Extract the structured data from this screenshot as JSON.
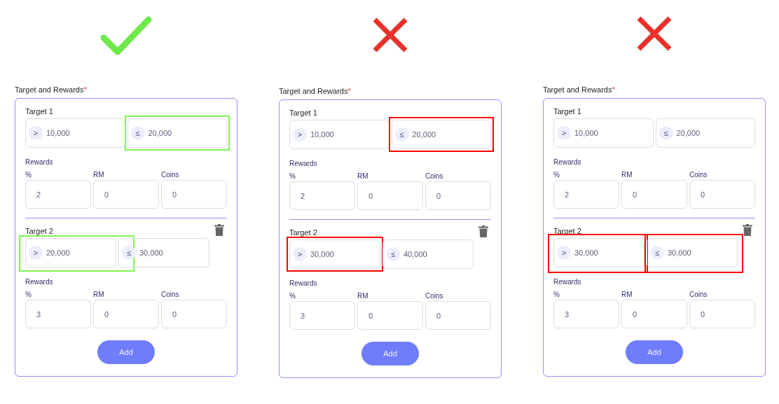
{
  "panels": [
    {
      "correct": true,
      "section_label": "Target and Rewards",
      "required_mark": "*",
      "targets": [
        {
          "title": "Target 1",
          "deletable": false,
          "range": [
            {
              "sign": ">",
              "value": "10,000",
              "highlighted": false
            },
            {
              "sign": "≤",
              "value": "20,000",
              "highlighted": true
            }
          ],
          "rewards_label": "Rewards",
          "rewards": [
            {
              "label": "%",
              "value": "2"
            },
            {
              "label": "RM",
              "value": "0"
            },
            {
              "label": "Coins",
              "value": "0"
            }
          ]
        },
        {
          "title": "Target 2",
          "deletable": true,
          "range": [
            {
              "sign": ">",
              "value": "20,000",
              "highlighted": true
            },
            {
              "sign": "≤",
              "value": "30,000",
              "highlighted": false
            }
          ],
          "rewards_label": "Rewards",
          "rewards": [
            {
              "label": "%",
              "value": "3"
            },
            {
              "label": "RM",
              "value": "0"
            },
            {
              "label": "Coins",
              "value": "0"
            }
          ]
        }
      ],
      "add_button": "Add"
    },
    {
      "correct": false,
      "section_label": "Target and Rewards",
      "required_mark": "*",
      "targets": [
        {
          "title": "Target 1",
          "deletable": false,
          "range": [
            {
              "sign": ">",
              "value": "10,000",
              "highlighted": false
            },
            {
              "sign": "≤",
              "value": "20,000",
              "highlighted": true
            }
          ],
          "rewards_label": "Rewards",
          "rewards": [
            {
              "label": "%",
              "value": "2"
            },
            {
              "label": "RM",
              "value": "0"
            },
            {
              "label": "Coins",
              "value": "0"
            }
          ]
        },
        {
          "title": "Target 2",
          "deletable": true,
          "range": [
            {
              "sign": ">",
              "value": "30,000",
              "highlighted": true
            },
            {
              "sign": "≤",
              "value": "40,000",
              "highlighted": false
            }
          ],
          "rewards_label": "Rewards",
          "rewards": [
            {
              "label": "%",
              "value": "3"
            },
            {
              "label": "RM",
              "value": "0"
            },
            {
              "label": "Coins",
              "value": "0"
            }
          ]
        }
      ],
      "add_button": "Add"
    },
    {
      "correct": false,
      "section_label": "Target and Rewards",
      "required_mark": "*",
      "targets": [
        {
          "title": "Target 1",
          "deletable": false,
          "range": [
            {
              "sign": ">",
              "value": "10,000",
              "highlighted": false
            },
            {
              "sign": "≤",
              "value": "20,000",
              "highlighted": false
            }
          ],
          "rewards_label": "Rewards",
          "rewards": [
            {
              "label": "%",
              "value": "2"
            },
            {
              "label": "RM",
              "value": "0"
            },
            {
              "label": "Coins",
              "value": "0"
            }
          ]
        },
        {
          "title": "Target 2",
          "deletable": true,
          "range": [
            {
              "sign": ">",
              "value": "30,000",
              "highlighted": true
            },
            {
              "sign": "≤",
              "value": "30,000",
              "highlighted": true
            }
          ],
          "rewards_label": "Rewards",
          "rewards": [
            {
              "label": "%",
              "value": "3"
            },
            {
              "label": "RM",
              "value": "0"
            },
            {
              "label": "Coins",
              "value": "0"
            }
          ]
        }
      ],
      "add_button": "Add"
    }
  ]
}
